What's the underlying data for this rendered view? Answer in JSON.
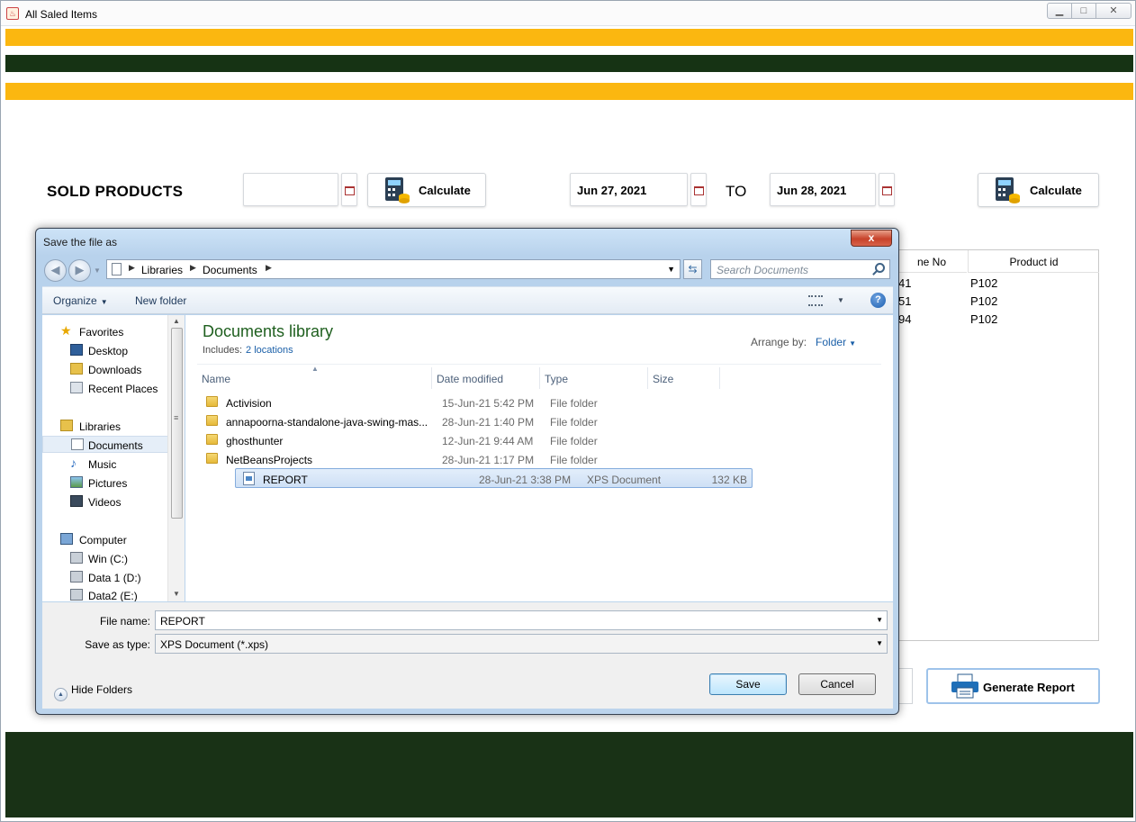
{
  "window": {
    "title": "All Saled Items",
    "minimize": "▁",
    "maximize": "□",
    "close": "✕"
  },
  "main": {
    "sold_title": "SOLD PRODUCTS",
    "calculate_label": "Calculate",
    "from_date": "Jun 27, 2021",
    "to_label": "TO",
    "to_date": "Jun 28, 2021",
    "single_date": "",
    "generate_report_label": "Generate Report",
    "colors": {
      "gold": "#fbb710",
      "dark_green": "#163314"
    }
  },
  "table": {
    "headers": [
      "ne No",
      "Product id"
    ],
    "rows": [
      [
        "41",
        "P102"
      ],
      [
        "51",
        "P102"
      ],
      [
        "94",
        "P102"
      ]
    ]
  },
  "dialog": {
    "title": "Save the file as",
    "close": "x",
    "breadcrumb": [
      "Libraries",
      "Documents"
    ],
    "search_placeholder": "Search Documents",
    "toolbar": {
      "organize": "Organize",
      "new_folder": "New folder",
      "help": "?"
    },
    "nav": {
      "favorites": "Favorites",
      "desktop": "Desktop",
      "downloads": "Downloads",
      "recent": "Recent Places",
      "libraries": "Libraries",
      "documents": "Documents",
      "music": "Music",
      "pictures": "Pictures",
      "videos": "Videos",
      "computer": "Computer",
      "win_c": "Win (C:)",
      "data1": "Data 1 (D:)",
      "data2": "Data2 (E:)"
    },
    "library": {
      "title": "Documents library",
      "includes_label": "Includes:",
      "includes_link": "2 locations",
      "arrange_label": "Arrange by:",
      "arrange_value": "Folder"
    },
    "columns": {
      "name": "Name",
      "date": "Date modified",
      "type": "Type",
      "size": "Size"
    },
    "files": [
      {
        "name": "Activision",
        "date": "15-Jun-21 5:42 PM",
        "type": "File folder",
        "size": ""
      },
      {
        "name": "annapoorna-standalone-java-swing-mas...",
        "date": "28-Jun-21 1:40 PM",
        "type": "File folder",
        "size": ""
      },
      {
        "name": "ghosthunter",
        "date": "12-Jun-21 9:44 AM",
        "type": "File folder",
        "size": ""
      },
      {
        "name": "NetBeansProjects",
        "date": "28-Jun-21 1:17 PM",
        "type": "File folder",
        "size": ""
      },
      {
        "name": "REPORT",
        "date": "28-Jun-21 3:38 PM",
        "type": "XPS Document",
        "size": "132 KB"
      }
    ],
    "file_name_label": "File name:",
    "file_name": "REPORT",
    "save_type_label": "Save as type:",
    "save_type": "XPS Document (*.xps)",
    "hide_folders": "Hide Folders",
    "save": "Save",
    "cancel": "Cancel"
  }
}
